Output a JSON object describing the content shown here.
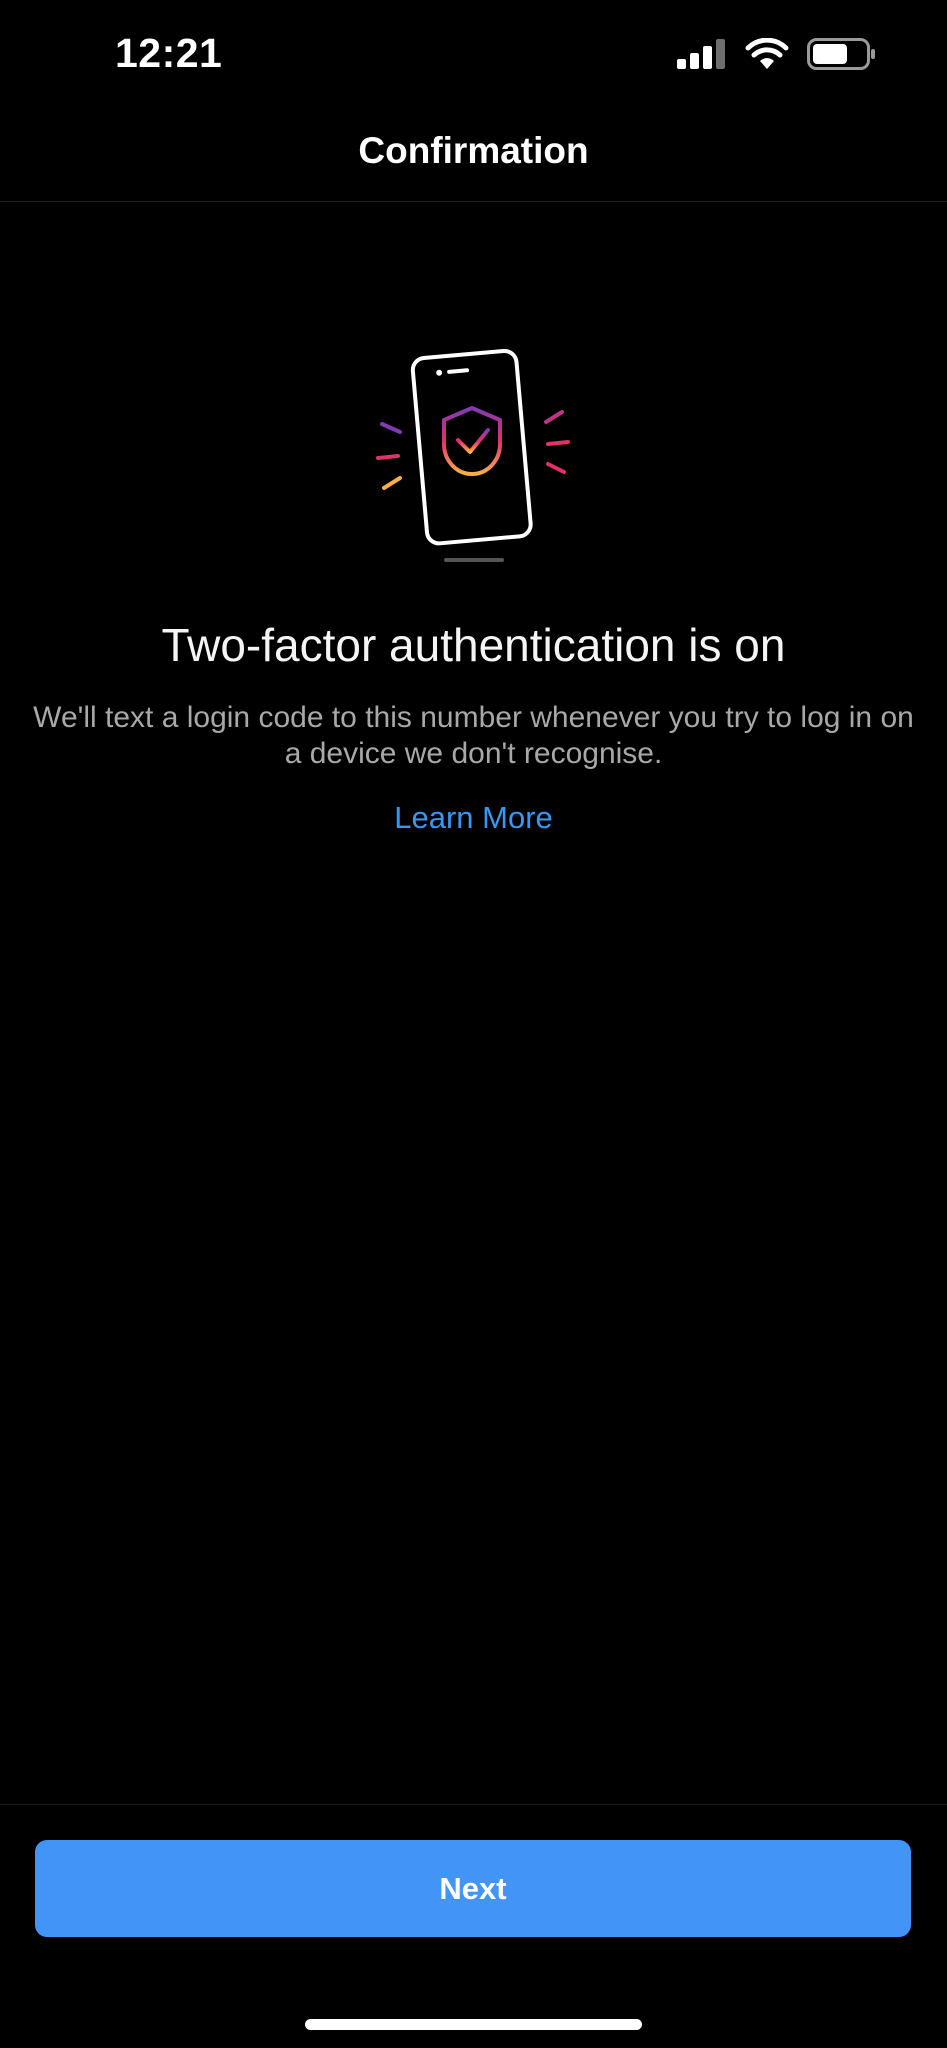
{
  "status_bar": {
    "time": "12:21",
    "icons": [
      "signal-icon",
      "wifi-icon",
      "battery-icon"
    ]
  },
  "header": {
    "title": "Confirmation"
  },
  "hero": {
    "icon": "phone-shield-check-icon",
    "colors": {
      "phone_outline": "#ffffff",
      "gradient_start": "#833ab4",
      "gradient_mid": "#e1306c",
      "gradient_end": "#fcaf45"
    }
  },
  "main": {
    "headline": "Two-factor authentication is on",
    "description": "We'll text a login code to this number whenever you try to log in on a device we don't recognise.",
    "learn_more_label": "Learn More"
  },
  "footer": {
    "next_label": "Next"
  },
  "colors": {
    "background": "#000000",
    "accent": "#4294f7",
    "link": "#3897f0",
    "secondary_text": "#a8a8a8"
  }
}
